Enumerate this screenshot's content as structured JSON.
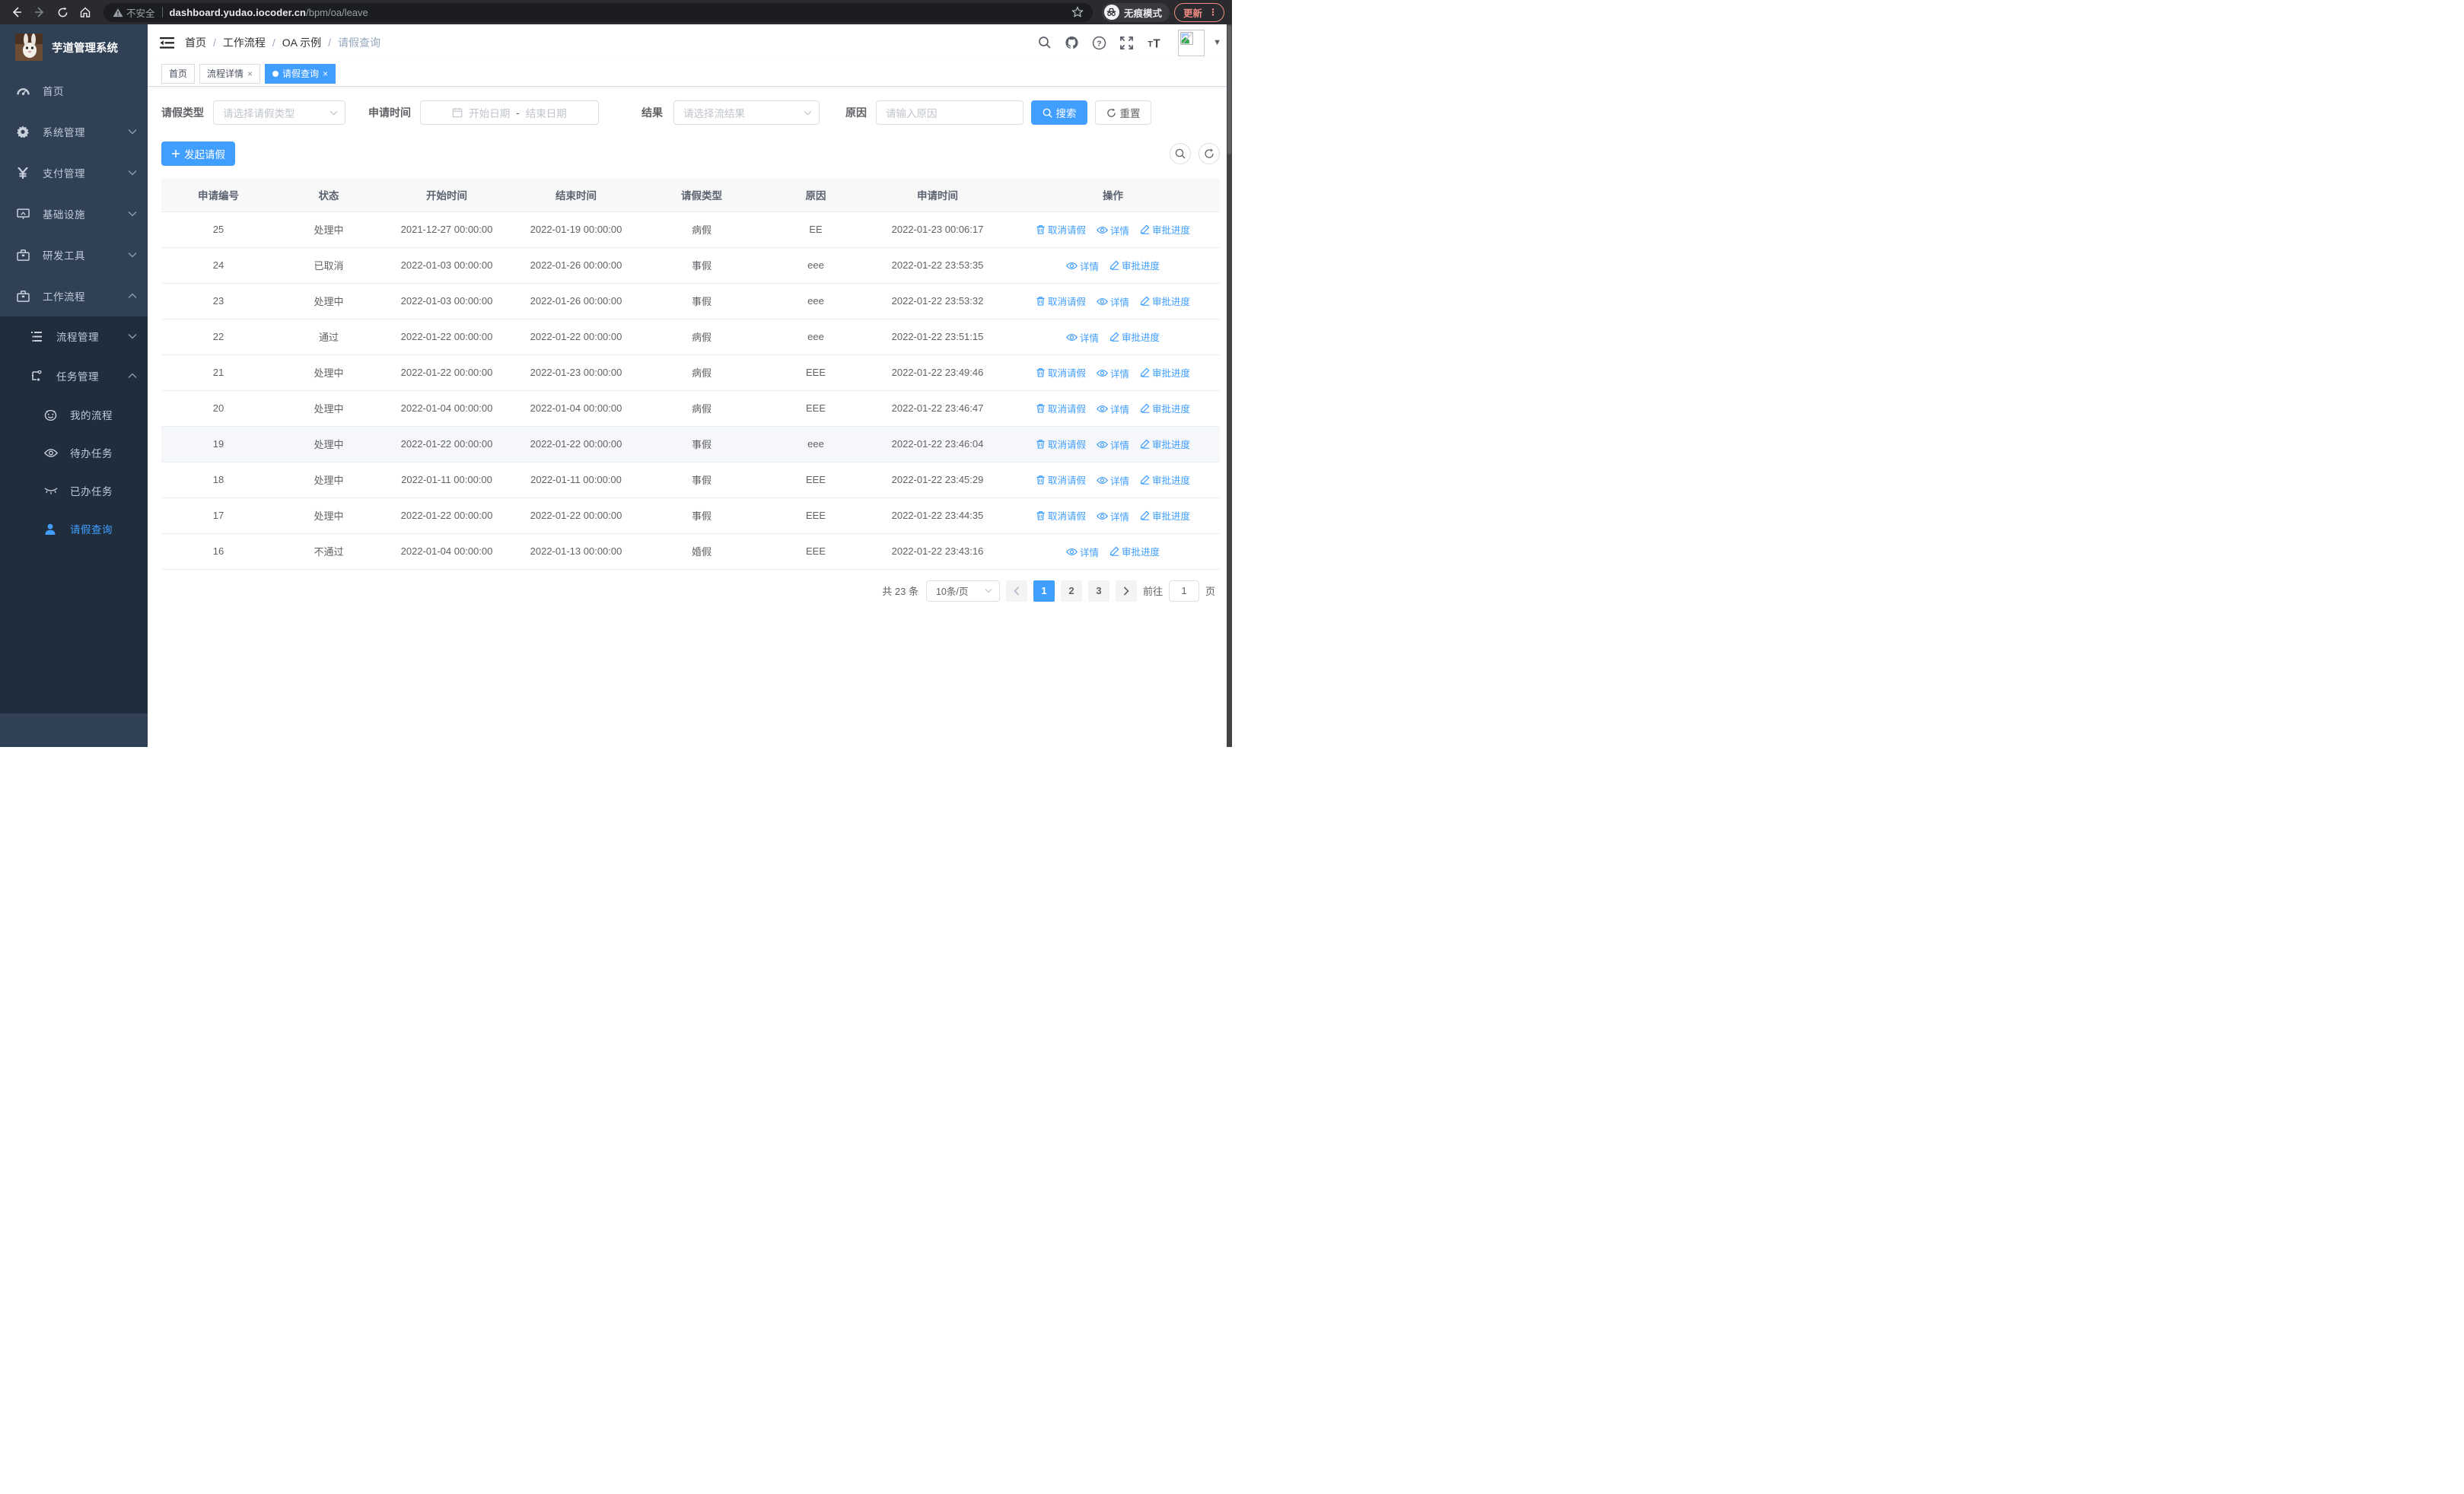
{
  "browser": {
    "security_label": "不安全",
    "url_host": "dashboard.yudao.iocoder.cn",
    "url_path": "/bpm/oa/leave",
    "incognito_label": "无痕模式",
    "update_label": "更新",
    "menu_dots": "⋮"
  },
  "sidebar": {
    "app_title": "芋道管理系统",
    "menu": [
      {
        "label": "首页",
        "icon": "dashboard-icon",
        "chevron": "none"
      },
      {
        "label": "系统管理",
        "icon": "gear-icon",
        "chevron": "down"
      },
      {
        "label": "支付管理",
        "icon": "yen-icon",
        "chevron": "down"
      },
      {
        "label": "基础设施",
        "icon": "monitor-icon",
        "chevron": "down"
      },
      {
        "label": "研发工具",
        "icon": "toolbox-icon",
        "chevron": "down"
      },
      {
        "label": "工作流程",
        "icon": "briefcase-icon",
        "chevron": "up"
      }
    ],
    "submenu": [
      {
        "label": "流程管理",
        "icon": "list-icon",
        "chevron": "down",
        "level": 2
      },
      {
        "label": "任务管理",
        "icon": "flow-icon",
        "chevron": "up",
        "level": 2
      },
      {
        "label": "我的流程",
        "icon": "face-icon",
        "level": 3
      },
      {
        "label": "待办任务",
        "icon": "eye-icon",
        "level": 3
      },
      {
        "label": "已办任务",
        "icon": "eye-closed-icon",
        "level": 3
      },
      {
        "label": "请假查询",
        "icon": "user-icon",
        "level": 3,
        "active": true
      }
    ]
  },
  "navbar": {
    "breadcrumb": [
      "首页",
      "工作流程",
      "OA 示例",
      "请假查询"
    ]
  },
  "tabs": [
    {
      "label": "首页",
      "closable": false,
      "active": false
    },
    {
      "label": "流程详情",
      "closable": true,
      "active": false
    },
    {
      "label": "请假查询",
      "closable": true,
      "active": true
    }
  ],
  "filters": {
    "leave_type_label": "请假类型",
    "leave_type_placeholder": "请选择请假类型",
    "apply_time_label": "申请时间",
    "start_placeholder": "开始日期",
    "range_separator": "-",
    "end_placeholder": "结束日期",
    "result_label": "结果",
    "result_placeholder": "请选择流结果",
    "reason_label": "原因",
    "reason_placeholder": "请输入原因",
    "search_label": "搜索",
    "reset_label": "重置"
  },
  "toolbar": {
    "create_label": "发起请假"
  },
  "table": {
    "columns": [
      "申请编号",
      "状态",
      "开始时间",
      "结束时间",
      "请假类型",
      "原因",
      "申请时间",
      "操作"
    ],
    "action_labels": {
      "cancel": "取消请假",
      "detail": "详情",
      "progress": "审批进度"
    },
    "rows": [
      {
        "id": "25",
        "status": "处理中",
        "start": "2021-12-27 00:00:00",
        "end": "2022-01-19 00:00:00",
        "type": "病假",
        "reason": "EE",
        "apply_time": "2022-01-23 00:06:17",
        "actions": [
          "cancel",
          "detail",
          "progress"
        ],
        "hover": false
      },
      {
        "id": "24",
        "status": "已取消",
        "start": "2022-01-03 00:00:00",
        "end": "2022-01-26 00:00:00",
        "type": "事假",
        "reason": "eee",
        "apply_time": "2022-01-22 23:53:35",
        "actions": [
          "detail",
          "progress"
        ],
        "hover": false
      },
      {
        "id": "23",
        "status": "处理中",
        "start": "2022-01-03 00:00:00",
        "end": "2022-01-26 00:00:00",
        "type": "事假",
        "reason": "eee",
        "apply_time": "2022-01-22 23:53:32",
        "actions": [
          "cancel",
          "detail",
          "progress"
        ],
        "hover": false
      },
      {
        "id": "22",
        "status": "通过",
        "start": "2022-01-22 00:00:00",
        "end": "2022-01-22 00:00:00",
        "type": "病假",
        "reason": "eee",
        "apply_time": "2022-01-22 23:51:15",
        "actions": [
          "detail",
          "progress"
        ],
        "hover": false
      },
      {
        "id": "21",
        "status": "处理中",
        "start": "2022-01-22 00:00:00",
        "end": "2022-01-23 00:00:00",
        "type": "病假",
        "reason": "EEE",
        "apply_time": "2022-01-22 23:49:46",
        "actions": [
          "cancel",
          "detail",
          "progress"
        ],
        "hover": false
      },
      {
        "id": "20",
        "status": "处理中",
        "start": "2022-01-04 00:00:00",
        "end": "2022-01-04 00:00:00",
        "type": "病假",
        "reason": "EEE",
        "apply_time": "2022-01-22 23:46:47",
        "actions": [
          "cancel",
          "detail",
          "progress"
        ],
        "hover": false
      },
      {
        "id": "19",
        "status": "处理中",
        "start": "2022-01-22 00:00:00",
        "end": "2022-01-22 00:00:00",
        "type": "事假",
        "reason": "eee",
        "apply_time": "2022-01-22 23:46:04",
        "actions": [
          "cancel",
          "detail",
          "progress"
        ],
        "hover": true
      },
      {
        "id": "18",
        "status": "处理中",
        "start": "2022-01-11 00:00:00",
        "end": "2022-01-11 00:00:00",
        "type": "事假",
        "reason": "EEE",
        "apply_time": "2022-01-22 23:45:29",
        "actions": [
          "cancel",
          "detail",
          "progress"
        ],
        "hover": false
      },
      {
        "id": "17",
        "status": "处理中",
        "start": "2022-01-22 00:00:00",
        "end": "2022-01-22 00:00:00",
        "type": "事假",
        "reason": "EEE",
        "apply_time": "2022-01-22 23:44:35",
        "actions": [
          "cancel",
          "detail",
          "progress"
        ],
        "hover": false
      },
      {
        "id": "16",
        "status": "不通过",
        "start": "2022-01-04 00:00:00",
        "end": "2022-01-13 00:00:00",
        "type": "婚假",
        "reason": "EEE",
        "apply_time": "2022-01-22 23:43:16",
        "actions": [
          "detail",
          "progress"
        ],
        "hover": false
      }
    ]
  },
  "pagination": {
    "total": "共 23 条",
    "page_size": "10条/页",
    "pages": [
      "1",
      "2",
      "3"
    ],
    "current": "1",
    "jump_prefix": "前往",
    "jump_value": "1",
    "jump_suffix": "页"
  },
  "colors": {
    "primary": "#409eff",
    "sidebar_bg": "#304156",
    "submenu_bg": "#1f2d3d"
  }
}
